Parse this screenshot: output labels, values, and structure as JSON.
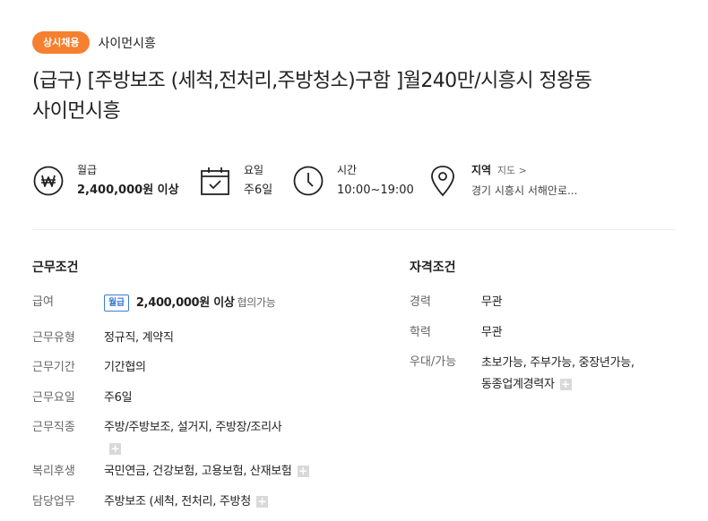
{
  "header": {
    "badge": "상시채용",
    "company": "사이먼시흥",
    "title_line1": "(급구) [주방보조 (세척,전처리,주방청소)구함 ]월240만/시흥시 정왕동",
    "title_line2": "사이먼시흥"
  },
  "summary": {
    "salary": {
      "label": "월급",
      "value": "2,400,000원 이상"
    },
    "days": {
      "label": "요일",
      "value": "주6일"
    },
    "hours": {
      "label": "시간",
      "value": "10:00~19:00"
    },
    "region": {
      "label": "지역",
      "link": "지도 >",
      "value": "경기 시흥시 서해안로..."
    }
  },
  "work_conditions": {
    "title": "근무조건",
    "salary_label": "급여",
    "salary_chip": "월급",
    "salary_value": "2,400,000원 이상",
    "salary_note": "협의가능",
    "type_label": "근무유형",
    "type_value": "정규직, 계약직",
    "period_label": "근무기간",
    "period_value": "기간협의",
    "days_label": "근무요일",
    "days_value": "주6일",
    "job_label": "근무직종",
    "job_value": "주방/주방보조, 설거지, 주방장/조리사",
    "welfare_label": "복리후생",
    "welfare_value": "국민연금, 건강보험, 고용보험, 산재보험",
    "duty_label": "담당업무",
    "duty_value": "주방보조 (세척, 전처리, 주방청"
  },
  "qualifications": {
    "title": "자격조건",
    "career_label": "경력",
    "career_value": "무관",
    "education_label": "학력",
    "education_value": "무관",
    "preference_label": "우대/가능",
    "preference_line1": "초보가능, 주부가능, 중장년가능,",
    "preference_line2": "동종업계경력자"
  },
  "icons": {
    "summary_salary": "won-circle-icon",
    "summary_days": "calendar-check-icon",
    "summary_hours": "clock-icon",
    "summary_region": "map-pin-icon",
    "expand": "plus-icon"
  },
  "colors": {
    "badge": "#f5802f",
    "salary_chip": "#3d7bd6",
    "muted_text": "#666666"
  }
}
